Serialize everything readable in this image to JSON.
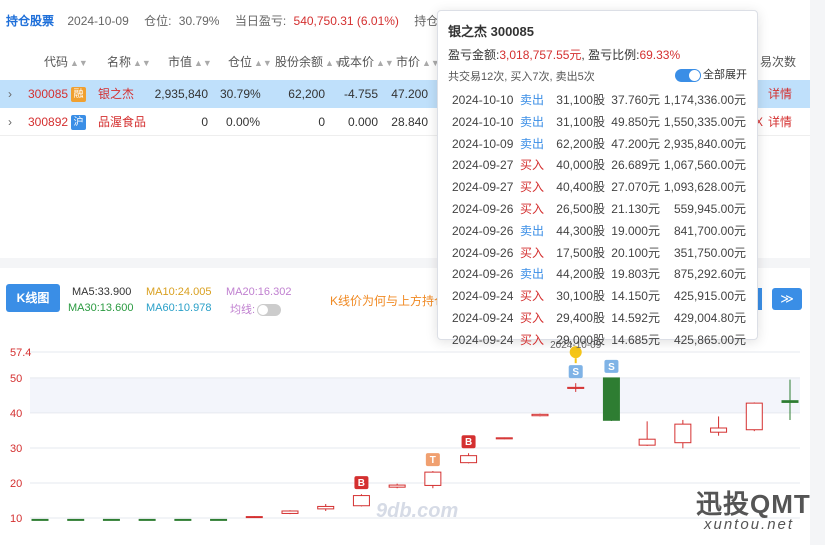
{
  "summary": {
    "title": "持仓股票",
    "date": "2024-10-09",
    "position_label": "仓位:",
    "position_value": "30.79%",
    "pnl_label": "当日盈亏:",
    "pnl_value": "540,750.31 (6.01%)",
    "hold_label": "持仓盈亏:"
  },
  "table": {
    "headers": [
      "代码",
      "名称",
      "市值",
      "仓位",
      "股份余额",
      "成本价",
      "市价"
    ],
    "extra_header": "易次数",
    "rows": [
      {
        "code": "300085",
        "badge": "融",
        "name": "银之杰",
        "mv": "2,935,840",
        "pos": "30.79%",
        "shares": "62,200",
        "cost": "-4.755",
        "price": "47.200",
        "tail": "详情"
      },
      {
        "code": "300892",
        "badge": "沪",
        "name": "品渥食品",
        "mv": "0",
        "pos": "0.00%",
        "shares": "0",
        "cost": "0.000",
        "price": "28.840",
        "tail_prefix": "X",
        "tail": "详情"
      }
    ]
  },
  "kline": {
    "button": "K线图",
    "ma5": "MA5:33.900",
    "ma10": "MA10:24.005",
    "ma20": "MA20:16.302",
    "ma30": "MA30:13.600",
    "ma60": "MA60:10.978",
    "avg_label": "均线:",
    "note": "K线价为何与上方持仓",
    "next_icon": "≫"
  },
  "popover": {
    "name": "银之杰 300085",
    "pnl_label": "盈亏金额:",
    "pnl_value": "3,018,757.55元",
    "ratio_label": ", 盈亏比例:",
    "ratio_value": "69.33%",
    "trade_summary": "共交易12次, 买入7次, 卖出5次",
    "expand_label": "全部展开",
    "transactions": [
      {
        "date": "2024-10-10",
        "type": "卖出",
        "qty": "31,100股",
        "price": "37.760元",
        "amount": "1,174,336.00元"
      },
      {
        "date": "2024-10-10",
        "type": "卖出",
        "qty": "31,100股",
        "price": "49.850元",
        "amount": "1,550,335.00元"
      },
      {
        "date": "2024-10-09",
        "type": "卖出",
        "qty": "62,200股",
        "price": "47.200元",
        "amount": "2,935,840.00元"
      },
      {
        "date": "2024-09-27",
        "type": "买入",
        "qty": "40,000股",
        "price": "26.689元",
        "amount": "1,067,560.00元"
      },
      {
        "date": "2024-09-27",
        "type": "买入",
        "qty": "40,400股",
        "price": "27.070元",
        "amount": "1,093,628.00元"
      },
      {
        "date": "2024-09-26",
        "type": "买入",
        "qty": "26,500股",
        "price": "21.130元",
        "amount": "559,945.00元"
      },
      {
        "date": "2024-09-26",
        "type": "卖出",
        "qty": "44,300股",
        "price": "19.000元",
        "amount": "841,700.00元"
      },
      {
        "date": "2024-09-26",
        "type": "买入",
        "qty": "17,500股",
        "price": "20.100元",
        "amount": "351,750.00元"
      },
      {
        "date": "2024-09-26",
        "type": "卖出",
        "qty": "44,200股",
        "price": "19.803元",
        "amount": "875,292.60元"
      },
      {
        "date": "2024-09-24",
        "type": "买入",
        "qty": "30,100股",
        "price": "14.150元",
        "amount": "425,915.00元"
      },
      {
        "date": "2024-09-24",
        "type": "买入",
        "qty": "29,400股",
        "price": "14.592元",
        "amount": "429,004.80元"
      },
      {
        "date": "2024-09-24",
        "type": "买入",
        "qty": "29,000股",
        "price": "14.685元",
        "amount": "425,865.00元"
      }
    ]
  },
  "chart_data": {
    "type": "candlestick",
    "y_ticks": [
      "57.4",
      "50",
      "40",
      "30",
      "20",
      "10"
    ],
    "ylim": [
      8,
      57.4
    ],
    "highlight_date": "2024-10-09",
    "candles": [
      {
        "o": 9.5,
        "c": 9.6,
        "h": 9.7,
        "l": 9.4,
        "up": false
      },
      {
        "o": 9.6,
        "c": 9.5,
        "h": 9.7,
        "l": 9.4,
        "up": false
      },
      {
        "o": 9.6,
        "c": 9.5,
        "h": 9.7,
        "l": 9.4,
        "up": false
      },
      {
        "o": 9.6,
        "c": 9.5,
        "h": 9.7,
        "l": 9.4,
        "up": false
      },
      {
        "o": 9.6,
        "c": 9.5,
        "h": 9.7,
        "l": 9.4,
        "up": false
      },
      {
        "o": 9.6,
        "c": 9.5,
        "h": 9.7,
        "l": 9.4,
        "up": false
      },
      {
        "o": 10.2,
        "c": 10.4,
        "h": 10.5,
        "l": 10.1,
        "up": true
      },
      {
        "o": 11.3,
        "c": 12.0,
        "h": 12.2,
        "l": 11.1,
        "up": true
      },
      {
        "o": 12.6,
        "c": 13.3,
        "h": 14.0,
        "l": 12.0,
        "up": true
      },
      {
        "o": 13.5,
        "c": 16.4,
        "h": 16.8,
        "l": 13.3,
        "up": true
      },
      {
        "o": 18.8,
        "c": 19.4,
        "h": 19.8,
        "l": 18.5,
        "up": true
      },
      {
        "o": 19.3,
        "c": 23.1,
        "h": 23.4,
        "l": 18.5,
        "up": true
      },
      {
        "o": 25.8,
        "c": 27.8,
        "h": 28.5,
        "l": 25.6,
        "up": true
      },
      {
        "o": 32.6,
        "c": 32.9,
        "h": 33.0,
        "l": 32.5,
        "up": true
      },
      {
        "o": 39.2,
        "c": 39.6,
        "h": 39.8,
        "l": 39.0,
        "up": true
      },
      {
        "o": 47.0,
        "c": 47.3,
        "h": 48.5,
        "l": 46.0,
        "up": true
      },
      {
        "o": 50.0,
        "c": 37.9,
        "h": 50.0,
        "l": 37.7,
        "up": false
      },
      {
        "o": 30.8,
        "c": 32.5,
        "h": 37.6,
        "l": 30.6,
        "up": true
      },
      {
        "o": 31.5,
        "c": 36.8,
        "h": 38.0,
        "l": 29.9,
        "up": true
      },
      {
        "o": 34.5,
        "c": 35.7,
        "h": 39.0,
        "l": 33.5,
        "up": true
      },
      {
        "o": 35.2,
        "c": 42.8,
        "h": 43.0,
        "l": 34.8,
        "up": true
      },
      {
        "o": 43.5,
        "c": 43.0,
        "h": 49.5,
        "l": 38.0,
        "up": false
      }
    ],
    "markers": [
      {
        "index": 9,
        "label": "B",
        "kind": "buy"
      },
      {
        "index": 11,
        "label": "T",
        "kind": "t"
      },
      {
        "index": 12,
        "label": "B",
        "kind": "buy"
      },
      {
        "index": 15,
        "label": "S",
        "kind": "sell"
      },
      {
        "index": 16,
        "label": "S",
        "kind": "sell"
      }
    ]
  },
  "watermark": {
    "brand": "迅投QMT",
    "site": "xuntou.net",
    "faint": "9db.com"
  }
}
